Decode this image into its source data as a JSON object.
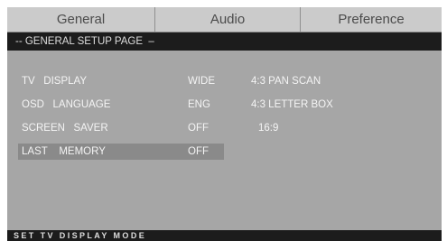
{
  "tabs": [
    {
      "label": "General"
    },
    {
      "label": "Audio"
    },
    {
      "label": "Preference"
    }
  ],
  "page_title": "-- GENERAL SETUP PAGE  –",
  "settings": [
    {
      "label": "TV   DISPLAY",
      "value": "WIDE"
    },
    {
      "label": "OSD   LANGUAGE",
      "value": "ENG"
    },
    {
      "label": "SCREEN   SAVER",
      "value": "OFF"
    },
    {
      "label": "LAST    MEMORY",
      "value": "OFF"
    }
  ],
  "options": [
    {
      "label": "4:3 PAN SCAN"
    },
    {
      "label": "4:3 LETTER BOX"
    },
    {
      "label": "16:9"
    }
  ],
  "status_text": "SET TV DISPLAY MODE",
  "colors": {
    "tab_bar": "#cbcbcb",
    "menu_background": "#a6a6a6",
    "header_bar": "#1c1c1c",
    "highlight": "#8a8a8a",
    "text": "#f4f4f4"
  }
}
